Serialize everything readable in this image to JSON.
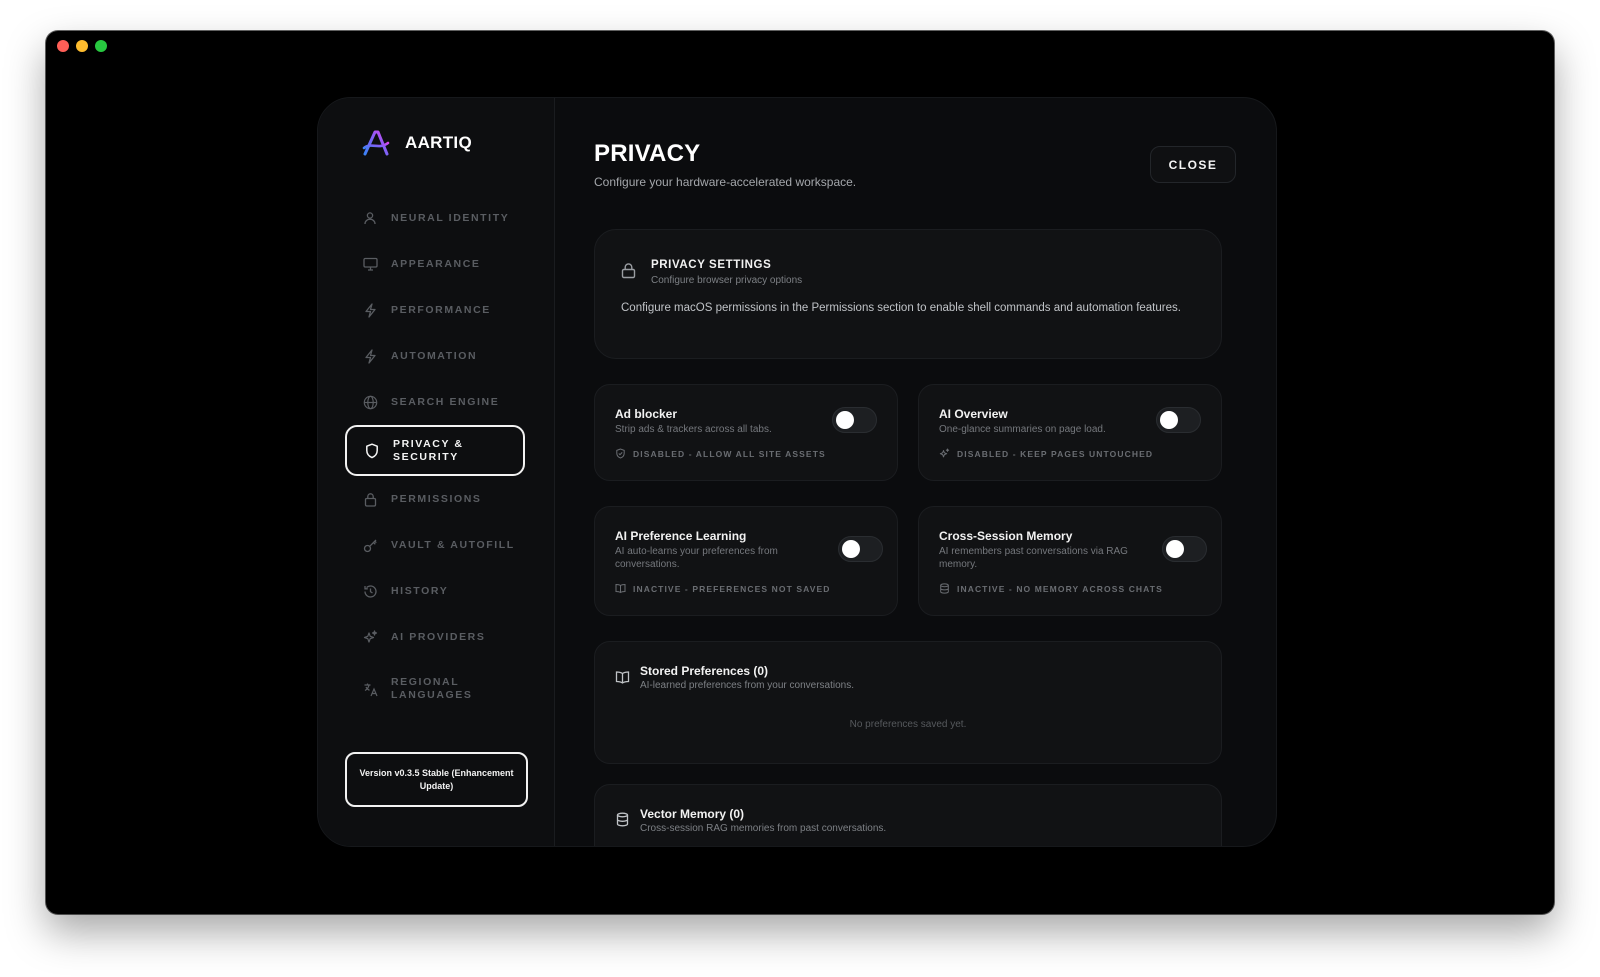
{
  "brand": {
    "name": "AARTIQ"
  },
  "sidebar": {
    "items": [
      {
        "label": "NEURAL IDENTITY",
        "icon": "user-icon"
      },
      {
        "label": "APPEARANCE",
        "icon": "monitor-icon"
      },
      {
        "label": "PERFORMANCE",
        "icon": "bolt-icon"
      },
      {
        "label": "AUTOMATION",
        "icon": "bolt-icon"
      },
      {
        "label": "SEARCH ENGINE",
        "icon": "globe-icon"
      },
      {
        "label": "PRIVACY & SECURITY",
        "icon": "shield-icon",
        "active": true
      },
      {
        "label": "PERMISSIONS",
        "icon": "lock-icon"
      },
      {
        "label": "VAULT & AUTOFILL",
        "icon": "key-icon"
      },
      {
        "label": "HISTORY",
        "icon": "history-icon"
      },
      {
        "label": "AI PROVIDERS",
        "icon": "sparkles-icon"
      },
      {
        "label": "REGIONAL LANGUAGES",
        "icon": "translate-icon"
      }
    ],
    "version": "Version v0.3.5 Stable (Enhancement Update)"
  },
  "header": {
    "title": "PRIVACY",
    "subtitle": "Configure your hardware-accelerated workspace.",
    "close_label": "CLOSE"
  },
  "privacy_settings": {
    "title": "PRIVACY SETTINGS",
    "subtitle": "Configure browser privacy options",
    "body": "Configure macOS permissions in the Permissions section to enable shell commands and automation features."
  },
  "toggles": {
    "ad_blocker": {
      "title": "Ad blocker",
      "desc": "Strip ads & trackers across all tabs.",
      "status": "DISABLED - ALLOW ALL SITE ASSETS",
      "enabled": false
    },
    "ai_overview": {
      "title": "AI Overview",
      "desc": "One-glance summaries on page load.",
      "status": "DISABLED - KEEP PAGES UNTOUCHED",
      "enabled": false
    },
    "ai_preference_learning": {
      "title": "AI Preference Learning",
      "desc": "AI auto-learns your preferences from conversations.",
      "status": "INACTIVE - PREFERENCES NOT SAVED",
      "enabled": false
    },
    "cross_session_memory": {
      "title": "Cross-Session Memory",
      "desc": "AI remembers past conversations via RAG memory.",
      "status": "INACTIVE - NO MEMORY ACROSS CHATS",
      "enabled": false
    }
  },
  "stored_preferences": {
    "title": "Stored Preferences (0)",
    "subtitle": "AI-learned preferences from your conversations.",
    "empty": "No preferences saved yet."
  },
  "vector_memory": {
    "title": "Vector Memory (0)",
    "subtitle": "Cross-session RAG memories from past conversations."
  },
  "colors": {
    "background": "#0b0c0e",
    "card": "#111214",
    "accent_logo_start": "#3b82f6",
    "accent_logo_end": "#d946ef"
  }
}
